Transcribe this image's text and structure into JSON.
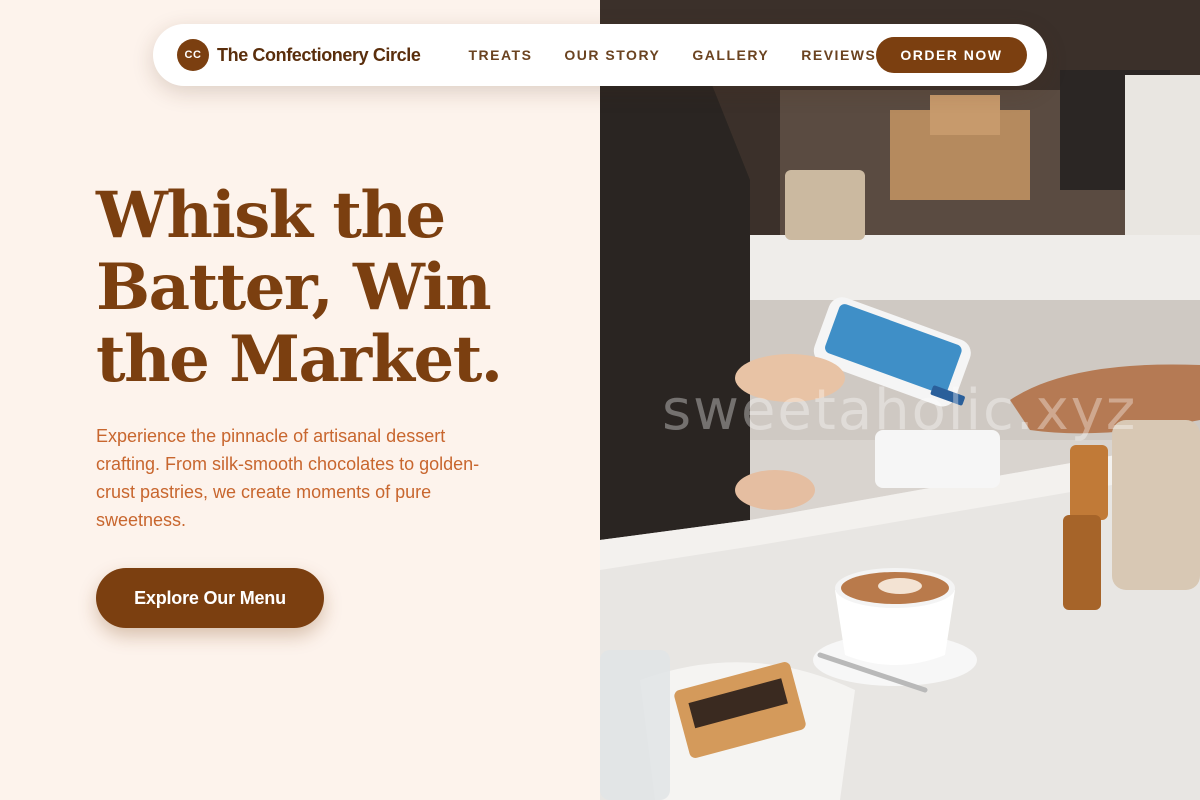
{
  "brand": {
    "logo_initials": "CC",
    "name": "The Confectionery Circle"
  },
  "nav": {
    "links": [
      "TREATS",
      "OUR STORY",
      "GALLERY",
      "REVIEWS"
    ],
    "cta_label": "ORDER NOW"
  },
  "hero": {
    "title_lines": [
      "Whisk the",
      "Batter, Win",
      "the Market."
    ],
    "subtitle": "Experience the pinnacle of artisanal dessert crafting. From silk-smooth chocolates to golden-crust pastries, we create moments of pure sweetness.",
    "cta_label": "Explore Our Menu"
  },
  "image": {
    "watermark": "sweetaholic.xyz"
  },
  "colors": {
    "background": "#fdf3ec",
    "accent": "#7b3f10",
    "subtitle": "#c8662e",
    "nav_bg": "#ffffff"
  }
}
